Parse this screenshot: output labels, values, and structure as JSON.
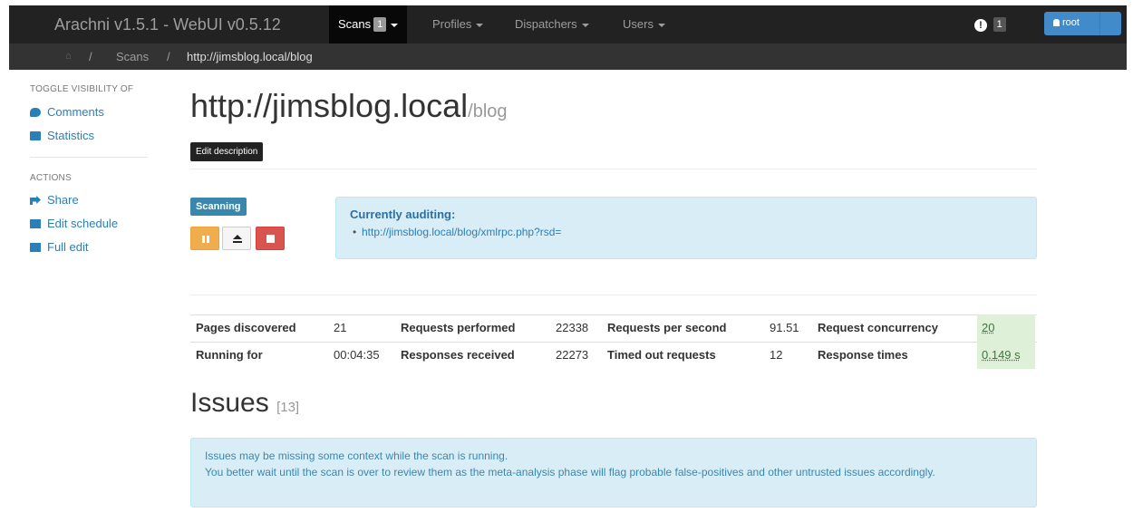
{
  "navbar": {
    "brand": "Arachni v1.5.1 - WebUI v0.5.12",
    "items": [
      {
        "label": "Scans",
        "badge": "1"
      },
      {
        "label": "Profiles"
      },
      {
        "label": "Dispatchers"
      },
      {
        "label": "Users"
      }
    ],
    "notification_count": "1",
    "user_label": "root"
  },
  "breadcrumb": {
    "scans": "Scans",
    "separator": "/",
    "current": "http://jimsblog.local/blog"
  },
  "sidebar": {
    "toggle_heading": "TOGGLE VISIBILITY OF",
    "toggle_items": [
      "Comments",
      "Statistics"
    ],
    "actions_heading": "ACTIONS",
    "action_items": [
      "Share",
      "Edit schedule",
      "Full edit"
    ]
  },
  "main": {
    "title_host": "http://jimsblog.local",
    "title_path": "/blog",
    "edit_description": "Edit description",
    "status_label": "Scanning",
    "audit_title": "Currently auditing:",
    "audit_url": "http://jimsblog.local/blog/xmlrpc.php?rsd="
  },
  "stats": {
    "pages_discovered_label": "Pages discovered",
    "pages_discovered": "21",
    "requests_performed_label": "Requests performed",
    "requests_performed": "22338",
    "requests_per_second_label": "Requests per second",
    "requests_per_second": "91.51",
    "request_concurrency_label": "Request concurrency",
    "request_concurrency": "20",
    "running_for_label": "Running for",
    "running_for": "00:04:35",
    "responses_received_label": "Responses received",
    "responses_received": "22273",
    "timed_out_label": "Timed out requests",
    "timed_out": "12",
    "response_times_label": "Response times",
    "response_times": "0.149 s"
  },
  "issues": {
    "heading": "Issues",
    "count": "[13]",
    "notice_line1": "Issues may be missing some context while the scan is running.",
    "notice_line2": "You better wait until the scan is over to review them as the meta-analysis phase will flag probable false-positives and other untrusted issues accordingly."
  },
  "colors": {
    "navbar": "#222222",
    "link": "#2a7fb8",
    "info_bg": "#d9edf7",
    "warning": "#f0ad4e",
    "danger": "#d9534f",
    "success_bg": "#dff0d8"
  },
  "icons": [
    "home-icon",
    "comments-icon",
    "statistics-icon",
    "share-icon",
    "calendar-icon",
    "edit-icon",
    "pause-icon",
    "suspend-icon",
    "abort-icon",
    "exclamation-icon",
    "user-icon"
  ]
}
